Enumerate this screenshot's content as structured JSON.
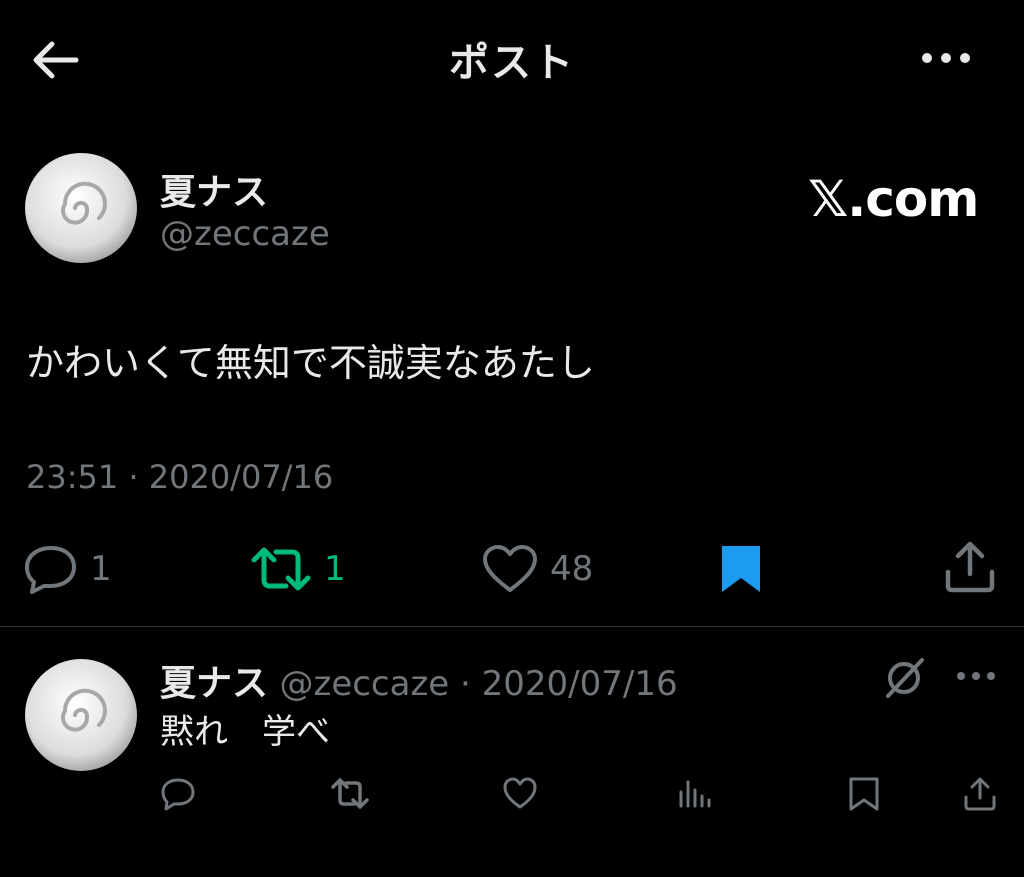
{
  "header": {
    "title": "ポスト"
  },
  "post": {
    "author_name": "夏ナス",
    "author_handle": "@zeccaze",
    "watermark": "𝕏.com",
    "text": "かわいくて無知で不誠実なあたし",
    "timestamp": "23:51 · 2020/07/16",
    "actions": {
      "reply_count": "1",
      "repost_count": "1",
      "like_count": "48"
    }
  },
  "reply": {
    "author_name": "夏ナス",
    "meta": "@zeccaze · 2020/07/16",
    "text": "黙れ　学べ"
  },
  "colors": {
    "background": "#000000",
    "text": "#e7e9ea",
    "muted": "#71767b",
    "repost_green": "#00ba7c",
    "bookmark_blue": "#1d9bf0",
    "divider": "#2f3336"
  },
  "icons": [
    "back-arrow-icon",
    "more-icon",
    "reply-icon",
    "repost-icon",
    "like-icon",
    "bookmark-icon",
    "share-icon",
    "grok-icon",
    "views-icon"
  ]
}
